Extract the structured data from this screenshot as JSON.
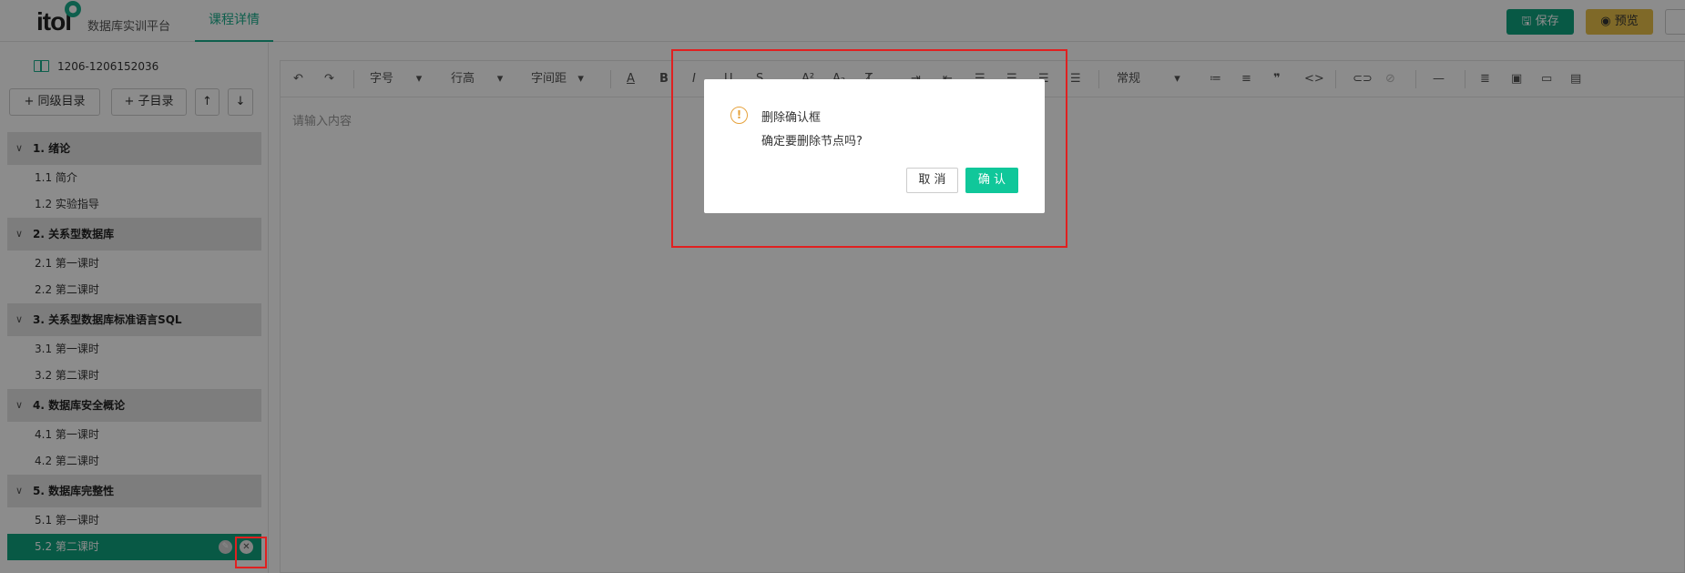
{
  "header": {
    "logo_text": "itol",
    "platform_name": "数据库实训平台",
    "tab_label": "课程详情",
    "save_label": "保存",
    "preview_label": "预览"
  },
  "sidebar": {
    "course_code": "1206-1206152036",
    "buttons": {
      "sibling_label": "同级目录",
      "child_label": "子目录"
    },
    "chapters": [
      {
        "title": "1. 绪论",
        "lessons": [
          "1.1 简介",
          "1.2 实验指导"
        ]
      },
      {
        "title": "2. 关系型数据库",
        "lessons": [
          "2.1 第一课时",
          "2.2 第二课时"
        ]
      },
      {
        "title": "3. 关系型数据库标准语言SQL",
        "lessons": [
          "3.1 第一课时",
          "3.2 第二课时"
        ]
      },
      {
        "title": "4. 数据库安全概论",
        "lessons": [
          "4.1 第一课时",
          "4.2 第二课时"
        ]
      },
      {
        "title": "5. 数据库完整性",
        "lessons": [
          "5.1 第一课时",
          "5.2 第二课时"
        ]
      }
    ],
    "active_lesson": "5.2 第二课时"
  },
  "editor": {
    "toolbar": {
      "font_size": "字号",
      "line_height": "行高",
      "letter_spacing": "字间距",
      "paragraph": "常规"
    },
    "placeholder": "请输入内容"
  },
  "dialog": {
    "title": "删除确认框",
    "message": "确定要删除节点吗?",
    "cancel_label": "取 消",
    "confirm_label": "确 认"
  },
  "colors": {
    "brand": "#10a37f",
    "confirm": "#10c79a",
    "warning": "#e6a23c",
    "highlight": "#e02020",
    "preview": "#e8c04a"
  }
}
